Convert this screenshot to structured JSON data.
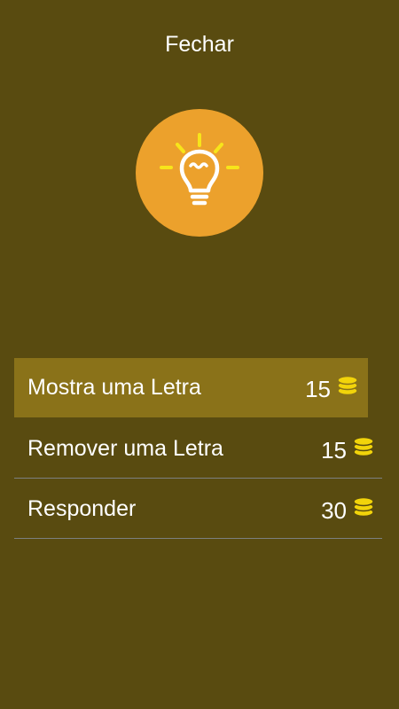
{
  "header": {
    "close_label": "Fechar"
  },
  "hint_icon": {
    "name": "lightbulb-icon",
    "circle_color": "#eca12c",
    "glyph_color": "#ffffff",
    "rays_color": "#f7e51a"
  },
  "options": [
    {
      "label": "Mostra uma Letra",
      "cost": "15",
      "icon": "coin-stack-icon",
      "highlighted": true
    },
    {
      "label": "Remover uma Letra",
      "cost": "15",
      "icon": "coin-stack-icon",
      "highlighted": false
    },
    {
      "label": "Responder",
      "cost": "30",
      "icon": "coin-stack-icon",
      "highlighted": false
    }
  ],
  "colors": {
    "background": "#594b10",
    "highlight": "#8a7219",
    "divider": "#7c8080",
    "coin": "#f2d40a"
  }
}
